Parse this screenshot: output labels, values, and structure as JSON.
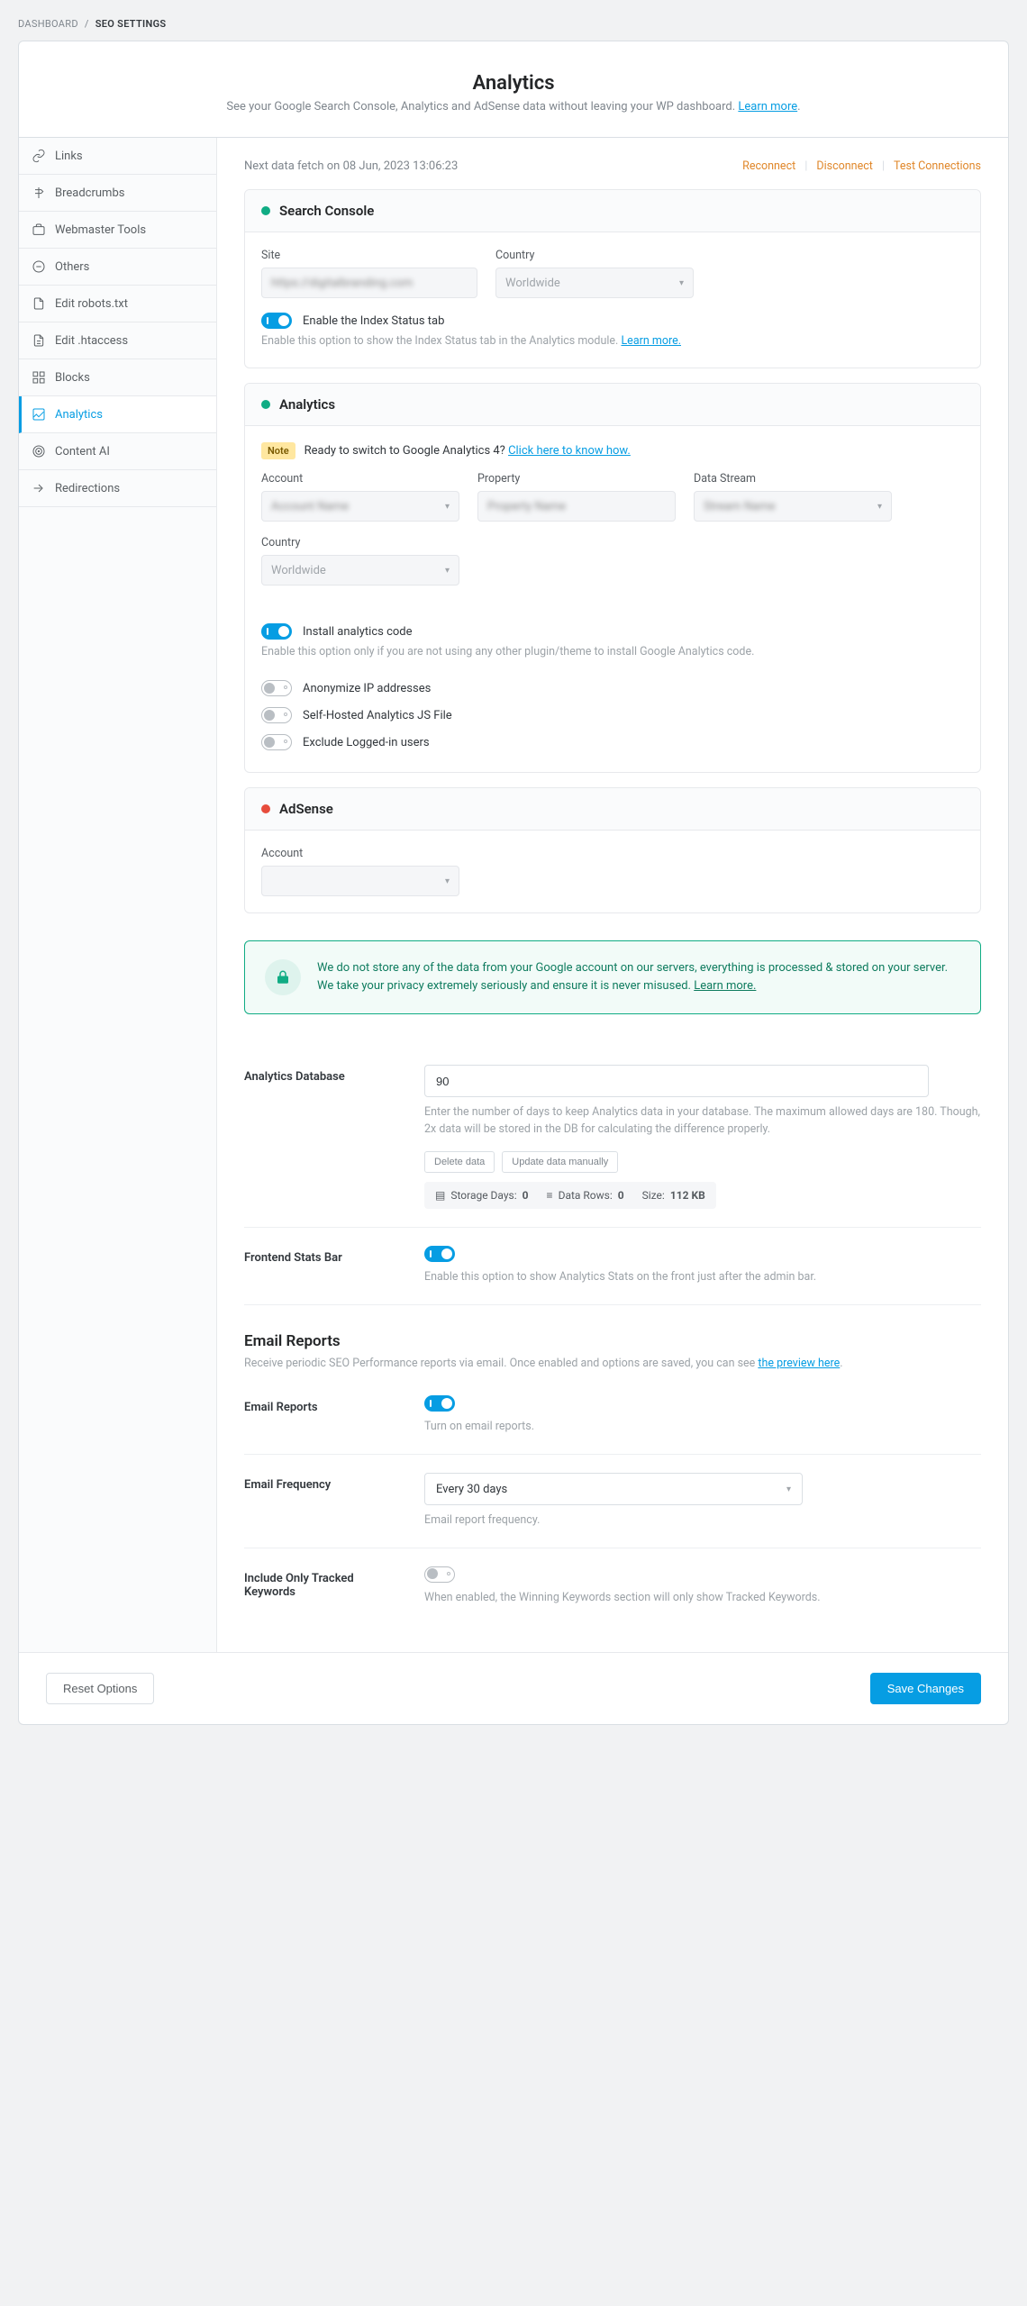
{
  "breadcrumb": {
    "root": "DASHBOARD",
    "current": "SEO SETTINGS"
  },
  "header": {
    "title": "Analytics",
    "subtitle": "See your Google Search Console, Analytics and AdSense data without leaving your WP dashboard.",
    "learn_more": "Learn more"
  },
  "sidebar": {
    "items": [
      {
        "label": "Links"
      },
      {
        "label": "Breadcrumbs"
      },
      {
        "label": "Webmaster Tools"
      },
      {
        "label": "Others"
      },
      {
        "label": "Edit robots.txt"
      },
      {
        "label": "Edit .htaccess"
      },
      {
        "label": "Blocks"
      },
      {
        "label": "Analytics"
      },
      {
        "label": "Content AI"
      },
      {
        "label": "Redirections"
      }
    ]
  },
  "fetch": {
    "text": "Next data fetch on 08 Jun, 2023 13:06:23",
    "reconnect": "Reconnect",
    "disconnect": "Disconnect",
    "test": "Test Connections"
  },
  "search_console": {
    "title": "Search Console",
    "site_label": "Site",
    "site_value": "https://digitalbranding.com",
    "country_label": "Country",
    "country_value": "Worldwide",
    "toggle_label": "Enable the Index Status tab",
    "toggle_desc": "Enable this option to show the Index Status tab in the Analytics module.",
    "learn_more": "Learn more."
  },
  "analytics": {
    "title": "Analytics",
    "note_badge": "Note",
    "note_text": "Ready to switch to Google Analytics 4?",
    "note_link": "Click here to know how.",
    "account_label": "Account",
    "account_value": "Account Name",
    "property_label": "Property",
    "property_value": "Property Name",
    "data_stream_label": "Data Stream",
    "data_stream_value": "Stream Name",
    "country_label": "Country",
    "country_value": "Worldwide",
    "install_label": "Install analytics code",
    "install_desc": "Enable this option only if you are not using any other plugin/theme to install Google Analytics code.",
    "anonymize_label": "Anonymize IP addresses",
    "selfhosted_label": "Self-Hosted Analytics JS File",
    "exclude_label": "Exclude Logged-in users"
  },
  "adsense": {
    "title": "AdSense",
    "account_label": "Account"
  },
  "privacy": {
    "text": "We do not store any of the data from your Google account on our servers, everything is processed & stored on your server. We take your privacy extremely seriously and ensure it is never misused.",
    "learn_more": "Learn more."
  },
  "db": {
    "label": "Analytics Database",
    "value": "90",
    "desc": "Enter the number of days to keep Analytics data in your database. The maximum allowed days are 180. Though, 2x data will be stored in the DB for calculating the difference properly.",
    "delete_btn": "Delete data",
    "update_btn": "Update data manually",
    "storage_label": "Storage Days:",
    "storage_value": "0",
    "rows_label": "Data Rows:",
    "rows_value": "0",
    "size_label": "Size:",
    "size_value": "112 KB"
  },
  "frontend": {
    "label": "Frontend Stats Bar",
    "desc": "Enable this option to show Analytics Stats on the front just after the admin bar."
  },
  "email_reports": {
    "head_title": "Email Reports",
    "head_desc": "Receive periodic SEO Performance reports via email. Once enabled and options are saved, you can see",
    "head_link": "the preview here",
    "toggle_label": "Email Reports",
    "toggle_desc": "Turn on email reports.",
    "freq_label": "Email Frequency",
    "freq_value": "Every 30 days",
    "freq_desc": "Email report frequency.",
    "tracked_label": "Include Only Tracked Keywords",
    "tracked_desc": "When enabled, the Winning Keywords section will only show Tracked Keywords."
  },
  "footer": {
    "reset": "Reset Options",
    "save": "Save Changes"
  }
}
